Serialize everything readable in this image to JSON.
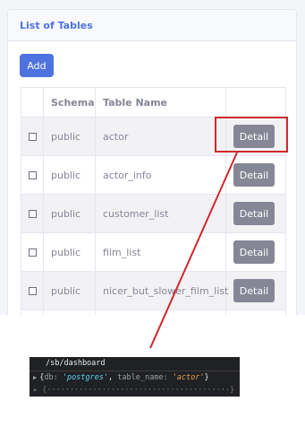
{
  "card": {
    "title": "List of Tables",
    "add_label": "Add"
  },
  "table": {
    "headers": [
      "",
      "Schema",
      "Table Name",
      ""
    ],
    "rows": [
      {
        "schema": "public",
        "name": "actor",
        "action": "Detail"
      },
      {
        "schema": "public",
        "name": "actor_info",
        "action": "Detail"
      },
      {
        "schema": "public",
        "name": "customer_list",
        "action": "Detail"
      },
      {
        "schema": "public",
        "name": "film_list",
        "action": "Detail"
      },
      {
        "schema": "public",
        "name": "nicer_but_slower_film_list",
        "action": "Detail"
      }
    ]
  },
  "console": {
    "url": "/sb/dashboard",
    "obj_open": "{",
    "db_key": "db:",
    "db_val": "'postgres'",
    "sep": ",",
    "table_key": "table_name:",
    "table_val": "'actor'",
    "obj_close": "}"
  },
  "colors": {
    "primary": "#4e73df",
    "secondary_button": "#858796",
    "highlight": "#d0282b",
    "console_bg": "#202124"
  }
}
